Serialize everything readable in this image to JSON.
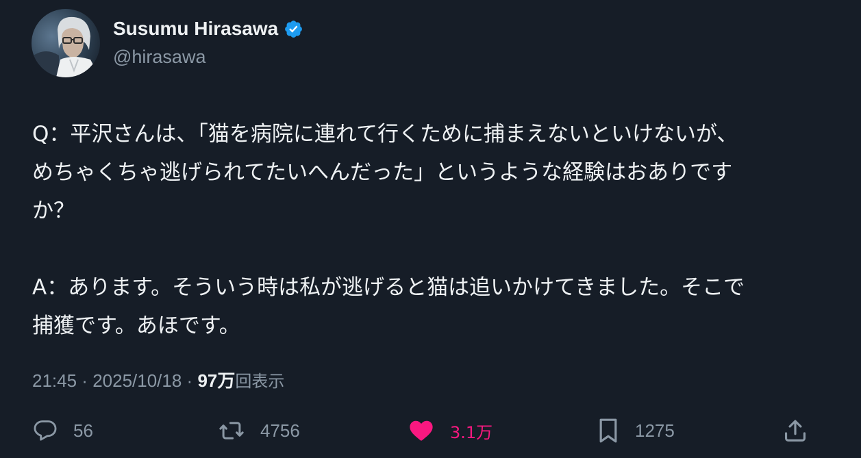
{
  "author": {
    "display_name": "Susumu Hirasawa",
    "handle": "@hirasawa",
    "verified_icon": "verified-badge-icon",
    "avatar_icon": "avatar"
  },
  "tweet": {
    "paragraphs": [
      [
        "Q：平沢さんは、「猫を病院に連れて行くために捕まえないといけないが、",
        "めちゃくちゃ逃げられてたいへんだった」というような経験はおありですか？"
      ],
      [
        "A：あります。そういう時は私が逃げると猫は追いかけてきました。そこで",
        "捕獲です。あほです。"
      ]
    ],
    "lines": {
      "l1": "Q：平沢さんは、「猫を病院に連れて行くために捕まえないといけないが、",
      "l2": "めちゃくちゃ逃げられてたいへんだった」というような経験はおありです",
      "l3": "か？",
      "l4": "A：あります。そういう時は私が逃げると猫は追いかけてきました。そこで",
      "l5": "捕獲です。あほです。"
    }
  },
  "meta": {
    "time": "21:45",
    "separator": " · ",
    "date": "2025/10/18",
    "views_count": "97万",
    "views_label": "回表示"
  },
  "actions": {
    "replies": {
      "icon": "reply-icon",
      "count": "56"
    },
    "reposts": {
      "icon": "repost-icon",
      "count": "4756"
    },
    "likes": {
      "icon": "heart-icon",
      "count": "3.1万",
      "active": true
    },
    "bookmarks": {
      "icon": "bookmark-icon",
      "count": "1275"
    },
    "share": {
      "icon": "share-icon"
    }
  },
  "colors": {
    "background": "#161d27",
    "text_primary": "#eef1f3",
    "text_secondary": "#8b98a5",
    "verified_blue": "#1d9bf0",
    "like_pink": "#f91880"
  }
}
